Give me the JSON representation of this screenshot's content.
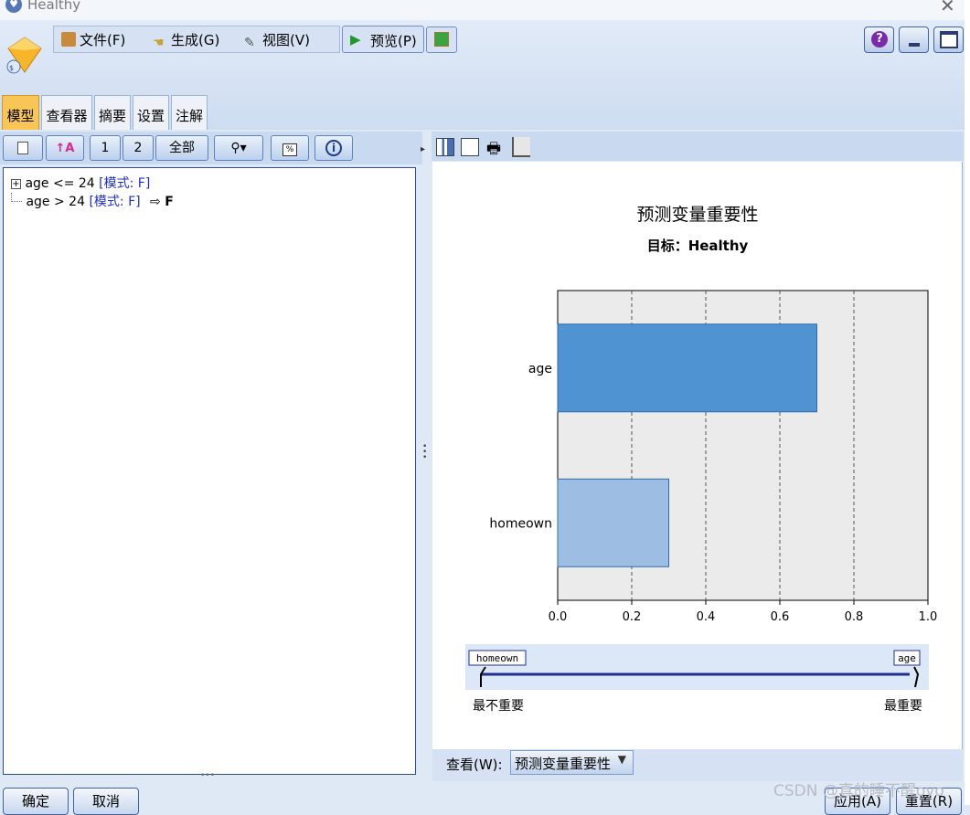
{
  "window": {
    "title": "Healthy"
  },
  "menu": {
    "file": "文件(F)",
    "generate": "生成(G)",
    "view": "视图(V)"
  },
  "toolbar": {
    "preview": "预览(P)"
  },
  "tabs": [
    {
      "label": "模型",
      "active": true
    },
    {
      "label": "查看器"
    },
    {
      "label": "摘要"
    },
    {
      "label": "设置"
    },
    {
      "label": "注解"
    }
  ],
  "left_toolbar": {
    "level1": "1",
    "level2": "2",
    "all": "全部"
  },
  "tree": [
    {
      "condition": "age <= 24",
      "mode": "[模式: F]",
      "result": ""
    },
    {
      "condition": "age > 24",
      "mode": "[模式: F]",
      "result": "F"
    }
  ],
  "chart_data": {
    "type": "bar",
    "title": "预测变量重要性",
    "subtitle": "目标：Healthy",
    "categories": [
      "age",
      "homeown"
    ],
    "values": [
      0.7,
      0.3
    ],
    "xlim": [
      0,
      1.0
    ],
    "ticks": [
      "0.0",
      "0.2",
      "0.4",
      "0.6",
      "0.8",
      "1.0"
    ],
    "grid": true,
    "colors": [
      "#4f93d3",
      "#9dbee2"
    ]
  },
  "slider": {
    "left_tag": "homeown",
    "right_tag": "age",
    "least_label": "最不重要",
    "most_label": "最重要"
  },
  "view": {
    "label": "查看(W):",
    "selected": "预测变量重要性"
  },
  "buttons": {
    "ok": "确定",
    "cancel": "取消",
    "apply": "应用(A)",
    "reset": "重置(R)"
  },
  "watermark": "CSDN @真的睡不醒ovo"
}
